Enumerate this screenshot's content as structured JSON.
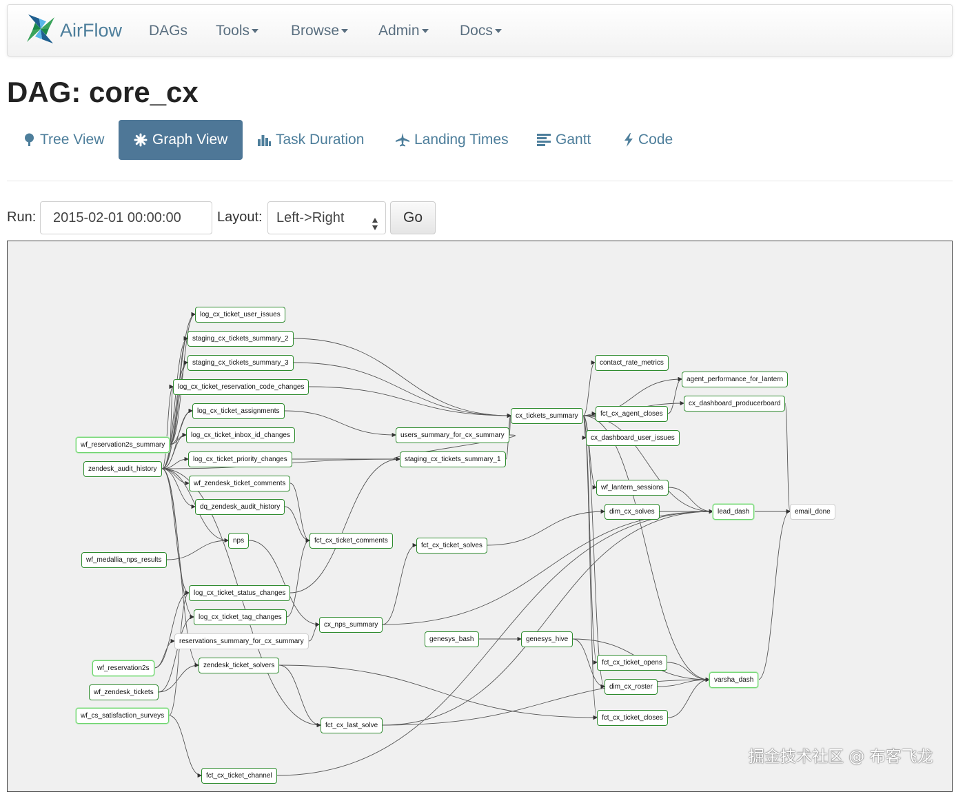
{
  "nav": {
    "brand": "AirFlow",
    "items": [
      {
        "label": "DAGs",
        "dropdown": false
      },
      {
        "label": "Tools",
        "dropdown": true
      },
      {
        "label": "Browse",
        "dropdown": true
      },
      {
        "label": "Admin",
        "dropdown": true
      },
      {
        "label": "Docs",
        "dropdown": true
      }
    ]
  },
  "page": {
    "title": "DAG: core_cx"
  },
  "tabs": [
    {
      "label": "Tree View",
      "icon": "tree-icon",
      "active": false
    },
    {
      "label": "Graph View",
      "icon": "asterisk-icon",
      "active": true
    },
    {
      "label": "Task Duration",
      "icon": "bar-chart-icon",
      "active": false
    },
    {
      "label": "Landing Times",
      "icon": "plane-icon",
      "active": false
    },
    {
      "label": "Gantt",
      "icon": "align-left-icon",
      "active": false
    },
    {
      "label": "Code",
      "icon": "flash-icon",
      "active": false
    }
  ],
  "controls": {
    "run_label": "Run:",
    "run_value": "2015-02-01 00:00:00",
    "layout_label": "Layout:",
    "layout_value": "Left->Right",
    "go_label": "Go"
  },
  "colors": {
    "nav_link": "#5a6f80",
    "brand": "#4d7e9b",
    "tab_active_bg": "#4e7797",
    "node_border_success": "#2e8b2e",
    "node_border_light": "#6ed46e",
    "node_border_none": "#cfcfcf",
    "graph_bg": "#f0f0f0",
    "edge": "#555555"
  },
  "graph": {
    "nodes": [
      {
        "id": "log_cx_ticket_user_issues",
        "label": "log_cx_ticket_user_issues",
        "state": "success"
      },
      {
        "id": "staging_cx_tickets_summary_2",
        "label": "staging_cx_tickets_summary_2",
        "state": "success"
      },
      {
        "id": "staging_cx_tickets_summary_3",
        "label": "staging_cx_tickets_summary_3",
        "state": "success"
      },
      {
        "id": "log_cx_ticket_reservation_code_changes",
        "label": "log_cx_ticket_reservation_code_changes",
        "state": "success"
      },
      {
        "id": "log_cx_ticket_assignments",
        "label": "log_cx_ticket_assignments",
        "state": "success"
      },
      {
        "id": "log_cx_ticket_inbox_id_changes",
        "label": "log_cx_ticket_inbox_id_changes",
        "state": "success"
      },
      {
        "id": "log_cx_ticket_priority_changes",
        "label": "log_cx_ticket_priority_changes",
        "state": "success"
      },
      {
        "id": "wf_zendesk_ticket_comments",
        "label": "wf_zendesk_ticket_comments",
        "state": "success"
      },
      {
        "id": "dq_zendesk_audit_history",
        "label": "dq_zendesk_audit_history",
        "state": "success"
      },
      {
        "id": "wf_reservation2s_summary",
        "label": "wf_reservation2s_summary",
        "state": "light"
      },
      {
        "id": "zendesk_audit_history",
        "label": "zendesk_audit_history",
        "state": "success"
      },
      {
        "id": "nps",
        "label": "nps",
        "state": "success"
      },
      {
        "id": "wf_medallia_nps_results",
        "label": "wf_medallia_nps_results",
        "state": "success"
      },
      {
        "id": "log_cx_ticket_status_changes",
        "label": "log_cx_ticket_status_changes",
        "state": "success"
      },
      {
        "id": "log_cx_ticket_tag_changes",
        "label": "log_cx_ticket_tag_changes",
        "state": "success"
      },
      {
        "id": "reservations_summary_for_cx_summary",
        "label": "reservations_summary_for_cx_summary",
        "state": "none"
      },
      {
        "id": "wf_reservation2s",
        "label": "wf_reservation2s",
        "state": "light"
      },
      {
        "id": "zendesk_ticket_solvers",
        "label": "zendesk_ticket_solvers",
        "state": "success"
      },
      {
        "id": "wf_zendesk_tickets",
        "label": "wf_zendesk_tickets",
        "state": "success"
      },
      {
        "id": "wf_cs_satisfaction_surveys",
        "label": "wf_cs_satisfaction_surveys",
        "state": "light"
      },
      {
        "id": "fct_cx_ticket_channel",
        "label": "fct_cx_ticket_channel",
        "state": "success"
      },
      {
        "id": "fct_cx_ticket_comments",
        "label": "fct_cx_ticket_comments",
        "state": "success"
      },
      {
        "id": "users_summary_for_cx_summary",
        "label": "users_summary_for_cx_summary",
        "state": "success"
      },
      {
        "id": "staging_cx_tickets_summary_1",
        "label": "staging_cx_tickets_summary_1",
        "state": "success"
      },
      {
        "id": "fct_cx_ticket_solves",
        "label": "fct_cx_ticket_solves",
        "state": "success"
      },
      {
        "id": "cx_nps_summary",
        "label": "cx_nps_summary",
        "state": "success"
      },
      {
        "id": "genesys_bash",
        "label": "genesys_bash",
        "state": "success"
      },
      {
        "id": "fct_cx_last_solve",
        "label": "fct_cx_last_solve",
        "state": "success"
      },
      {
        "id": "cx_tickets_summary",
        "label": "cx_tickets_summary",
        "state": "success"
      },
      {
        "id": "genesys_hive",
        "label": "genesys_hive",
        "state": "success"
      },
      {
        "id": "contact_rate_metrics",
        "label": "contact_rate_metrics",
        "state": "success"
      },
      {
        "id": "fct_cx_agent_closes",
        "label": "fct_cx_agent_closes",
        "state": "success"
      },
      {
        "id": "cx_dashboard_user_issues",
        "label": "cx_dashboard_user_issues",
        "state": "success"
      },
      {
        "id": "wf_lantern_sessions",
        "label": "wf_lantern_sessions",
        "state": "success"
      },
      {
        "id": "dim_cx_solves",
        "label": "dim_cx_solves",
        "state": "success"
      },
      {
        "id": "fct_cx_ticket_opens",
        "label": "fct_cx_ticket_opens",
        "state": "success"
      },
      {
        "id": "dim_cx_roster",
        "label": "dim_cx_roster",
        "state": "success"
      },
      {
        "id": "fct_cx_ticket_closes",
        "label": "fct_cx_ticket_closes",
        "state": "success"
      },
      {
        "id": "agent_performance_for_lantern",
        "label": "agent_performance_for_lantern",
        "state": "success"
      },
      {
        "id": "cx_dashboard_producerboard",
        "label": "cx_dashboard_producerboard",
        "state": "success"
      },
      {
        "id": "lead_dash",
        "label": "lead_dash",
        "state": "light"
      },
      {
        "id": "varsha_dash",
        "label": "varsha_dash",
        "state": "light"
      },
      {
        "id": "email_done",
        "label": "email_done",
        "state": "none"
      }
    ],
    "edges": [
      [
        "wf_reservation2s_summary",
        "log_cx_ticket_user_issues"
      ],
      [
        "wf_reservation2s_summary",
        "staging_cx_tickets_summary_2"
      ],
      [
        "wf_reservation2s_summary",
        "staging_cx_tickets_summary_3"
      ],
      [
        "wf_reservation2s_summary",
        "log_cx_ticket_reservation_code_changes"
      ],
      [
        "wf_reservation2s_summary",
        "log_cx_ticket_assignments"
      ],
      [
        "wf_reservation2s_summary",
        "log_cx_ticket_inbox_id_changes"
      ],
      [
        "zendesk_audit_history",
        "log_cx_ticket_user_issues"
      ],
      [
        "zendesk_audit_history",
        "staging_cx_tickets_summary_2"
      ],
      [
        "zendesk_audit_history",
        "staging_cx_tickets_summary_3"
      ],
      [
        "zendesk_audit_history",
        "log_cx_ticket_reservation_code_changes"
      ],
      [
        "zendesk_audit_history",
        "log_cx_ticket_assignments"
      ],
      [
        "zendesk_audit_history",
        "log_cx_ticket_inbox_id_changes"
      ],
      [
        "zendesk_audit_history",
        "log_cx_ticket_priority_changes"
      ],
      [
        "zendesk_audit_history",
        "wf_zendesk_ticket_comments"
      ],
      [
        "zendesk_audit_history",
        "dq_zendesk_audit_history"
      ],
      [
        "zendesk_audit_history",
        "nps"
      ],
      [
        "zendesk_audit_history",
        "log_cx_ticket_status_changes"
      ],
      [
        "zendesk_audit_history",
        "log_cx_ticket_tag_changes"
      ],
      [
        "zendesk_audit_history",
        "staging_cx_tickets_summary_1"
      ],
      [
        "zendesk_audit_history",
        "fct_cx_last_solve"
      ],
      [
        "zendesk_audit_history",
        "zendesk_ticket_solvers"
      ],
      [
        "wf_medallia_nps_results",
        "nps"
      ],
      [
        "wf_reservation2s",
        "reservations_summary_for_cx_summary"
      ],
      [
        "wf_reservation2s",
        "log_cx_ticket_status_changes"
      ],
      [
        "wf_zendesk_tickets",
        "zendesk_ticket_solvers"
      ],
      [
        "wf_zendesk_tickets",
        "log_cx_ticket_tag_changes"
      ],
      [
        "wf_cs_satisfaction_surveys",
        "fct_cx_ticket_channel"
      ],
      [
        "wf_cs_satisfaction_surveys",
        "log_cx_ticket_status_changes"
      ],
      [
        "wf_zendesk_ticket_comments",
        "fct_cx_ticket_comments"
      ],
      [
        "dq_zendesk_audit_history",
        "fct_cx_ticket_comments"
      ],
      [
        "nps",
        "cx_nps_summary"
      ],
      [
        "log_cx_ticket_status_changes",
        "staging_cx_tickets_summary_1"
      ],
      [
        "log_cx_ticket_tag_changes",
        "fct_cx_ticket_comments"
      ],
      [
        "log_cx_ticket_assignments",
        "users_summary_for_cx_summary"
      ],
      [
        "log_cx_ticket_priority_changes",
        "staging_cx_tickets_summary_1"
      ],
      [
        "zendesk_ticket_solvers",
        "fct_cx_last_solve"
      ],
      [
        "zendesk_ticket_solvers",
        "fct_cx_ticket_closes"
      ],
      [
        "reservations_summary_for_cx_summary",
        "cx_nps_summary"
      ],
      [
        "staging_cx_tickets_summary_2",
        "cx_tickets_summary"
      ],
      [
        "staging_cx_tickets_summary_3",
        "cx_tickets_summary"
      ],
      [
        "log_cx_ticket_reservation_code_changes",
        "cx_tickets_summary"
      ],
      [
        "users_summary_for_cx_summary",
        "cx_tickets_summary"
      ],
      [
        "users_summary_for_cx_summary",
        "staging_cx_tickets_summary_1"
      ],
      [
        "staging_cx_tickets_summary_1",
        "cx_tickets_summary"
      ],
      [
        "fct_cx_ticket_solves",
        "dim_cx_solves"
      ],
      [
        "cx_nps_summary",
        "fct_cx_ticket_solves"
      ],
      [
        "cx_nps_summary",
        "lead_dash"
      ],
      [
        "genesys_bash",
        "genesys_hive"
      ],
      [
        "genesys_hive",
        "varsha_dash"
      ],
      [
        "genesys_hive",
        "dim_cx_roster"
      ],
      [
        "fct_cx_last_solve",
        "lead_dash"
      ],
      [
        "fct_cx_last_solve",
        "varsha_dash"
      ],
      [
        "fct_cx_ticket_channel",
        "lead_dash"
      ],
      [
        "cx_tickets_summary",
        "contact_rate_metrics"
      ],
      [
        "cx_tickets_summary",
        "agent_performance_for_lantern"
      ],
      [
        "cx_tickets_summary",
        "fct_cx_agent_closes"
      ],
      [
        "cx_tickets_summary",
        "cx_dashboard_user_issues"
      ],
      [
        "cx_tickets_summary",
        "cx_dashboard_producerboard"
      ],
      [
        "cx_tickets_summary",
        "wf_lantern_sessions"
      ],
      [
        "cx_tickets_summary",
        "lead_dash"
      ],
      [
        "cx_tickets_summary",
        "fct_cx_ticket_opens"
      ],
      [
        "cx_tickets_summary",
        "dim_cx_roster"
      ],
      [
        "cx_tickets_summary",
        "fct_cx_ticket_closes"
      ],
      [
        "cx_tickets_summary",
        "varsha_dash"
      ],
      [
        "fct_cx_agent_closes",
        "agent_performance_for_lantern"
      ],
      [
        "wf_lantern_sessions",
        "lead_dash"
      ],
      [
        "dim_cx_solves",
        "lead_dash"
      ],
      [
        "fct_cx_ticket_opens",
        "varsha_dash"
      ],
      [
        "dim_cx_roster",
        "varsha_dash"
      ],
      [
        "fct_cx_ticket_closes",
        "varsha_dash"
      ],
      [
        "cx_dashboard_producerboard",
        "email_done"
      ],
      [
        "lead_dash",
        "email_done"
      ],
      [
        "varsha_dash",
        "email_done"
      ]
    ]
  },
  "watermark": "掘金技术社区 @ 布客飞龙"
}
